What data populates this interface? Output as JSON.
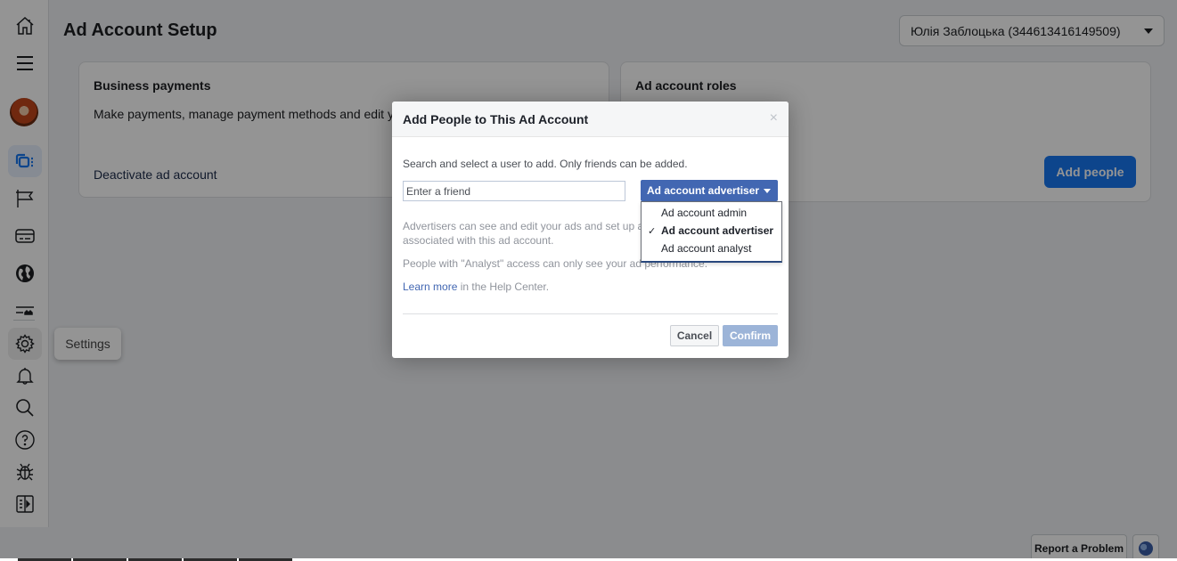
{
  "page": {
    "title": "Ad Account Setup",
    "account_selector": "Юлія Заблоцька (344613416149509)"
  },
  "sidebar": {
    "items": [
      {
        "name": "home",
        "icon": "home-icon"
      },
      {
        "name": "menu",
        "icon": "hamburger-icon"
      },
      {
        "name": "profile",
        "icon": "avatar"
      },
      {
        "name": "ad-accounts",
        "icon": "ad-accounts-icon",
        "active": true
      },
      {
        "name": "pages",
        "icon": "flag-icon"
      },
      {
        "name": "billing",
        "icon": "credit-card-icon"
      },
      {
        "name": "global",
        "icon": "globe-icon"
      },
      {
        "name": "tools",
        "icon": "tools-icon"
      },
      {
        "name": "settings",
        "icon": "gear-icon"
      },
      {
        "name": "notifications",
        "icon": "bell-icon"
      },
      {
        "name": "search",
        "icon": "search-icon"
      },
      {
        "name": "help",
        "icon": "help-icon"
      },
      {
        "name": "report-bug",
        "icon": "bug-icon"
      },
      {
        "name": "expand",
        "icon": "panel-expand-icon"
      }
    ],
    "tooltip": "Settings"
  },
  "cards": {
    "business_payments": {
      "title": "Business payments",
      "description": "Make payments, manage payment methods and edit y",
      "link": "Deactivate ad account"
    },
    "ad_account_roles": {
      "title": "Ad account roles",
      "button": "Add people"
    }
  },
  "modal": {
    "title": "Add People to This Ad Account",
    "close": "×",
    "instructions": "Search and select a user to add. Only friends can be added.",
    "friend_input": {
      "value": "",
      "placeholder": "Enter a friend"
    },
    "role_select": {
      "selected": "Ad account advertiser",
      "options": [
        "Ad account admin",
        "Ad account advertiser",
        "Ad account analyst"
      ],
      "check": "✓"
    },
    "desc_advertiser": "Advertisers can see and edit your ads and set up a method associated with this ad account.",
    "desc_analyst": "People with \"Analyst\" access can only see your ad performance.",
    "learn_more_link": "Learn more",
    "learn_more_suffix": " in the Help Center.",
    "cancel": "Cancel",
    "confirm": "Confirm"
  },
  "footer": {
    "report_problem": "Report a Problem"
  },
  "colors": {
    "accent": "#1877f2",
    "dialog_blue": "#4267b2",
    "confirm_disabled": "#9cb4d8"
  }
}
